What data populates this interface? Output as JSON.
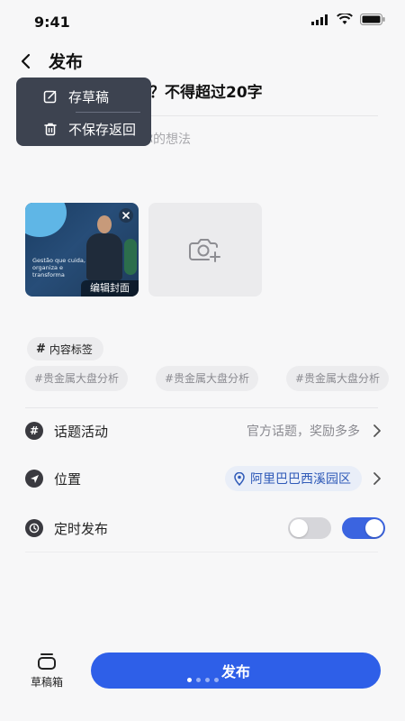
{
  "status_bar": {
    "time": "9:41"
  },
  "header": {
    "title": "发布"
  },
  "popup_menu": {
    "items": [
      {
        "icon": "edit-square-icon",
        "label": "存草稿"
      },
      {
        "icon": "trash-icon",
        "label": "不保存返回"
      }
    ]
  },
  "editor": {
    "title_placeholder": "啥…………对平息？不得超过20字",
    "body_placeholder": "……………留言说说你的想法"
  },
  "media": {
    "thumbnail": {
      "headline": "Gestão que cuida, organiza e transforma",
      "cover_label": "编辑封面"
    }
  },
  "tags": {
    "main_label": "内容标签",
    "suggestions": [
      "#贵金属大盘分析",
      "#贵金属大盘分析",
      "#贵金属大盘分析"
    ]
  },
  "settings": {
    "topic": {
      "label": "话题活动",
      "value": "官方话题，奖励多多"
    },
    "location": {
      "label": "位置",
      "value": "阿里巴巴西溪园区"
    },
    "schedule": {
      "label": "定时发布",
      "toggle_a": false,
      "toggle_b": true
    }
  },
  "bottom_bar": {
    "drafts_label": "草稿箱",
    "publish_label": "发布"
  },
  "colors": {
    "accent": "#2e5fe8",
    "menu_bg": "#3d4350",
    "location_text": "#2f5ab8"
  }
}
